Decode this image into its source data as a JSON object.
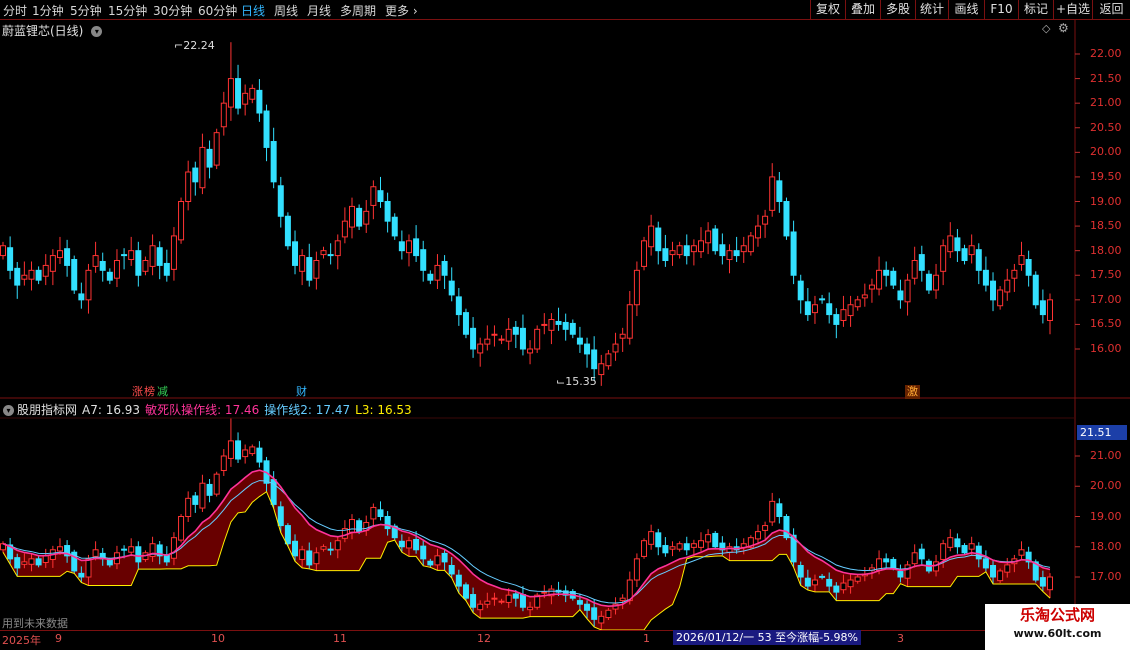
{
  "toolbar": {
    "timeframes": [
      "分时",
      "1分钟",
      "5分钟",
      "15分钟",
      "30分钟",
      "60分钟",
      "日线",
      "周线",
      "月线",
      "多周期",
      "更多"
    ],
    "active_timeframe": "日线",
    "buttons": [
      "复权",
      "叠加",
      "多股",
      "统计",
      "画线",
      "F10",
      "标记",
      "+自选",
      "返回"
    ]
  },
  "main_chart": {
    "title": "蔚蓝锂芯(日线)",
    "high_label": "22.24",
    "low_label": "15.35",
    "price_ticks": [
      "22.00",
      "21.50",
      "21.00",
      "20.50",
      "20.00",
      "19.50",
      "19.00",
      "18.50",
      "18.00",
      "17.50",
      "17.00",
      "16.50",
      "16.00"
    ],
    "tags": [
      {
        "text": "涨",
        "color": "#ff4d4d"
      },
      {
        "text": "榜",
        "color": "#ff4d4d"
      },
      {
        "text": "减",
        "color": "#33cc55"
      },
      {
        "text": "财",
        "color": "#33b7ff"
      },
      {
        "text": "激",
        "color": "#ffaa33"
      }
    ]
  },
  "indicator": {
    "name": "股朋指标网",
    "a7_label": "A7: 16.93",
    "line1_label": "敏死队操作线: 17.46",
    "line2_label": "操作线2: 17.47",
    "l3_label": "L3: 16.53",
    "price_ticks": [
      "21.00",
      "20.00",
      "19.00",
      "18.00",
      "17.00"
    ],
    "current_value": "21.51",
    "future_note": "用到未来数据"
  },
  "time_axis": {
    "year": "2025年",
    "months": [
      "9",
      "10",
      "11",
      "12",
      "1",
      "3"
    ],
    "range_text": "2026/01/12/一 53 至今涨幅-5.98%"
  },
  "watermark": {
    "line1": "乐淘公式网",
    "line2": "www.60lt.com"
  },
  "colors": {
    "up": "#ff3333",
    "down": "#33e0ff",
    "line1": "#ff3399",
    "line2": "#66ccff",
    "a7": "#ffee00",
    "fill": "#7a0000"
  },
  "chart_data": {
    "type": "candlestick",
    "title": "蔚蓝锂芯(日线)",
    "ylim": [
      15.35,
      22.24
    ],
    "closes": [
      18.1,
      17.6,
      17.3,
      17.5,
      17.6,
      17.4,
      17.7,
      17.9,
      18.0,
      17.7,
      17.2,
      17.0,
      17.6,
      17.9,
      17.6,
      17.4,
      17.8,
      17.9,
      18.0,
      17.5,
      17.8,
      18.1,
      17.7,
      17.5,
      18.3,
      19.0,
      19.6,
      19.4,
      20.1,
      19.7,
      20.4,
      21.0,
      21.5,
      20.9,
      21.2,
      21.3,
      20.8,
      20.1,
      19.4,
      18.7,
      18.1,
      17.7,
      17.9,
      17.4,
      17.8,
      18.0,
      17.9,
      18.2,
      18.6,
      18.9,
      18.5,
      18.8,
      19.3,
      19.0,
      18.6,
      18.3,
      18.0,
      18.2,
      17.9,
      17.6,
      17.4,
      17.7,
      17.5,
      17.1,
      16.7,
      16.3,
      16.0,
      16.1,
      16.2,
      16.3,
      16.2,
      16.4,
      16.3,
      16.0,
      16.0,
      16.4,
      16.5,
      16.6,
      16.5,
      16.4,
      16.3,
      16.1,
      15.9,
      15.6,
      15.7,
      15.9,
      16.1,
      16.3,
      16.9,
      17.6,
      18.2,
      18.5,
      18.0,
      17.8,
      18.0,
      18.1,
      17.9,
      18.1,
      18.2,
      18.4,
      18.0,
      17.9,
      18.0,
      17.9,
      18.1,
      18.3,
      18.5,
      18.7,
      19.5,
      19.0,
      18.3,
      17.5,
      17.0,
      16.7,
      16.9,
      17.0,
      16.7,
      16.5,
      16.8,
      16.9,
      17.0,
      17.1,
      17.3,
      17.6,
      17.5,
      17.3,
      17.0,
      17.4,
      17.8,
      17.6,
      17.2,
      17.5,
      18.1,
      18.3,
      18.0,
      17.8,
      18.1,
      17.6,
      17.3,
      17.0,
      17.2,
      17.4,
      17.6,
      17.9,
      17.5,
      16.9,
      16.7,
      17.0
    ]
  }
}
